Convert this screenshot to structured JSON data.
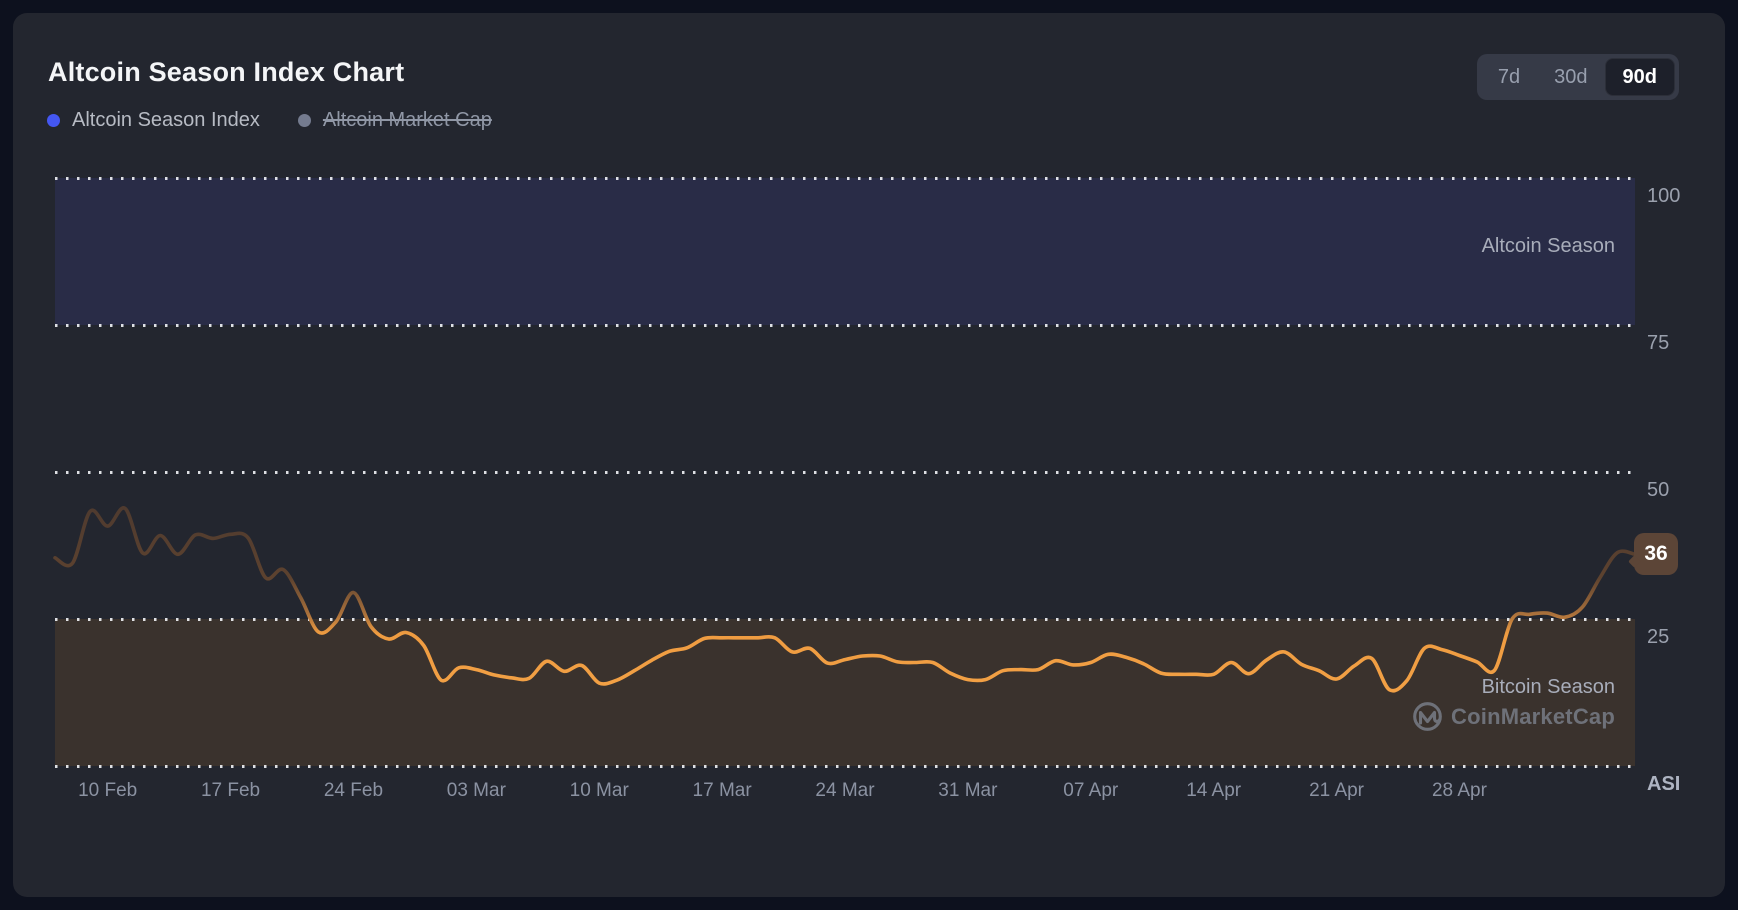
{
  "card": {
    "title": "Altcoin Season Index Chart"
  },
  "legend": {
    "items": [
      {
        "label": "Altcoin Season Index",
        "color": "#4457f2",
        "active": true
      },
      {
        "label": "Altcoin Market Cap",
        "color": "#747b8f",
        "active": false
      }
    ]
  },
  "range_switcher": {
    "options": [
      {
        "label": "7d"
      },
      {
        "label": "30d"
      },
      {
        "label": "90d"
      }
    ],
    "selected": "90d"
  },
  "chart_data": {
    "type": "line",
    "title": "Altcoin Season Index Chart",
    "series_name": "Altcoin Season Index",
    "ylim": [
      0,
      100
    ],
    "grid": "dotted-horizontal",
    "y_ticks": [
      {
        "label": "100",
        "value": 100,
        "emphasis": false
      },
      {
        "label": "75",
        "value": 75,
        "emphasis": false
      },
      {
        "label": "50",
        "value": 50,
        "emphasis": false
      },
      {
        "label": "25",
        "value": 25,
        "emphasis": false
      },
      {
        "label": "ASI",
        "value": 0,
        "emphasis": true
      }
    ],
    "x_ticks": [
      {
        "label": "10 Feb",
        "index": 3
      },
      {
        "label": "17 Feb",
        "index": 10
      },
      {
        "label": "24 Feb",
        "index": 17
      },
      {
        "label": "03 Mar",
        "index": 24
      },
      {
        "label": "10 Mar",
        "index": 31
      },
      {
        "label": "17 Mar",
        "index": 38
      },
      {
        "label": "24 Mar",
        "index": 45
      },
      {
        "label": "31 Mar",
        "index": 52
      },
      {
        "label": "07 Apr",
        "index": 59
      },
      {
        "label": "14 Apr",
        "index": 66
      },
      {
        "label": "21 Apr",
        "index": 73
      },
      {
        "label": "28 Apr",
        "index": 80
      }
    ],
    "zones": [
      {
        "label": "Altcoin Season",
        "from": 75,
        "to": 100,
        "color": "#292c47"
      },
      {
        "label": "Bitcoin Season",
        "from": 0,
        "to": 25,
        "color": "#3a322d"
      }
    ],
    "values": [
      35.4,
      34.5,
      43.3,
      40.8,
      43.8,
      36.2,
      39.2,
      36.0,
      39.3,
      38.7,
      39.4,
      38.8,
      32.0,
      33.4,
      28.6,
      22.8,
      24.5,
      29.5,
      23.7,
      21.6,
      22.7,
      20.5,
      14.6,
      16.7,
      16.4,
      15.5,
      15.0,
      14.9,
      17.8,
      16.1,
      17.1,
      14.1,
      14.6,
      16.2,
      18.0,
      19.5,
      20.1,
      21.7,
      21.8,
      21.8,
      21.8,
      21.8,
      19.4,
      20.0,
      17.5,
      18.1,
      18.7,
      18.7,
      17.7,
      17.6,
      17.6,
      15.8,
      14.7,
      14.7,
      16.2,
      16.4,
      16.4,
      17.9,
      17.2,
      17.6,
      19.0,
      18.5,
      17.4,
      15.8,
      15.6,
      15.6,
      15.6,
      17.6,
      15.7,
      18.0,
      19.4,
      17.3,
      16.2,
      14.8,
      17.0,
      18.3,
      13.0,
      14.5,
      20.0,
      19.8,
      18.8,
      17.7,
      16.3,
      25.0,
      25.8,
      26.0,
      25.3,
      27.0,
      32.0,
      36.3,
      36.0
    ],
    "current_value": 36,
    "current_value_label": "36",
    "line_gradient_stops": [
      {
        "offset": 0,
        "color": "#3e322d"
      },
      {
        "offset": 0.52,
        "color": "#4a382f"
      },
      {
        "offset": 0.68,
        "color": "#5d422f"
      },
      {
        "offset": 0.74,
        "color": "#a76f3b"
      },
      {
        "offset": 0.775,
        "color": "#ef9c41"
      },
      {
        "offset": 1,
        "color": "#f6a74a"
      }
    ]
  },
  "watermark": {
    "brand": "CoinMarketCap"
  },
  "colors": {
    "page_background": "#0d111e",
    "card_background": "#23262f",
    "accent_blue": "#4457f2",
    "line_orange": "#f6a74a",
    "line_dark": "#46362e",
    "badge_background": "#5c4537",
    "gridline_dots": "#eef0f4",
    "axis_label": "#9aa0ad"
  }
}
